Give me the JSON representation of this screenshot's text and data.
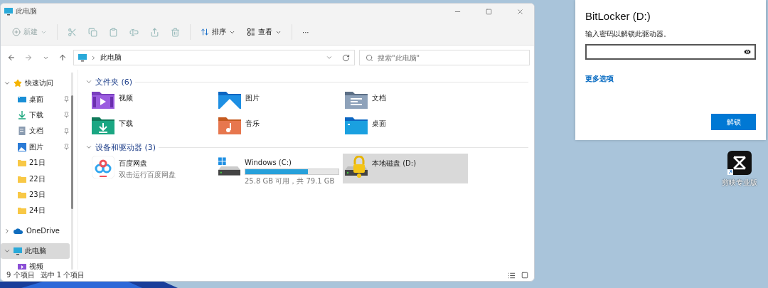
{
  "explorer": {
    "title": "此电脑",
    "toolbar": {
      "new": {
        "label": "新建",
        "disabled": true
      },
      "actions_disabled": true,
      "sort": "排序",
      "view": "查看",
      "more": "···"
    },
    "address": {
      "path": "此电脑",
      "search_placeholder": "搜索\"此电脑\""
    },
    "sidebar": [
      {
        "label": "快速访问",
        "kind": "star",
        "expanded": true,
        "selected": false,
        "children": [
          {
            "label": "桌面",
            "kind": "desktop",
            "pinned": true,
            "selected": false
          },
          {
            "label": "下载",
            "kind": "download",
            "pinned": true,
            "selected": false
          },
          {
            "label": "文档",
            "kind": "document",
            "pinned": true,
            "selected": false
          },
          {
            "label": "图片",
            "kind": "picture",
            "pinned": true,
            "selected": false
          },
          {
            "label": "21日",
            "kind": "folder",
            "pinned": false,
            "selected": false
          },
          {
            "label": "22日",
            "kind": "folder",
            "pinned": false,
            "selected": false
          },
          {
            "label": "23日",
            "kind": "folder",
            "pinned": false,
            "selected": false
          },
          {
            "label": "24日",
            "kind": "folder",
            "pinned": false,
            "selected": false
          }
        ]
      },
      {
        "label": "OneDrive",
        "kind": "cloud",
        "expanded": false,
        "selected": false
      },
      {
        "label": "此电脑",
        "kind": "pc",
        "expanded": true,
        "selected": true,
        "children": [
          {
            "label": "视频",
            "kind": "video",
            "pinned": false,
            "selected": false
          }
        ]
      }
    ],
    "groups": [
      {
        "title": "文件夹 (6)",
        "expanded": true,
        "items": [
          {
            "kind": "video",
            "name": "视频",
            "selected": false
          },
          {
            "kind": "picture",
            "name": "图片",
            "selected": false
          },
          {
            "kind": "document",
            "name": "文档",
            "selected": false
          },
          {
            "kind": "download",
            "name": "下载",
            "selected": false
          },
          {
            "kind": "music",
            "name": "音乐",
            "selected": false
          },
          {
            "kind": "desktop",
            "name": "桌面",
            "selected": false
          }
        ]
      },
      {
        "title": "设备和驱动器 (3)",
        "expanded": true,
        "items": [
          {
            "kind": "app",
            "name": "百度网盘",
            "detail": "双击运行百度网盘",
            "selected": false
          },
          {
            "kind": "drive",
            "name": "Windows (C:)",
            "level": 0.67,
            "detail": "25.8 GB 可用，共 79.1 GB",
            "selected": false
          },
          {
            "kind": "locked-drive",
            "name": "本地磁盘 (D:)",
            "selected": true
          }
        ]
      }
    ],
    "status": [
      "9 个项目",
      "选中 1 个项目"
    ]
  },
  "dialog": {
    "title": "BitLocker (D:)",
    "prompt": "输入密码以解锁此驱动器。",
    "link": "更多选项",
    "button": "解锁"
  },
  "desktop_icons": [
    {
      "label": "剪映专业版"
    }
  ]
}
